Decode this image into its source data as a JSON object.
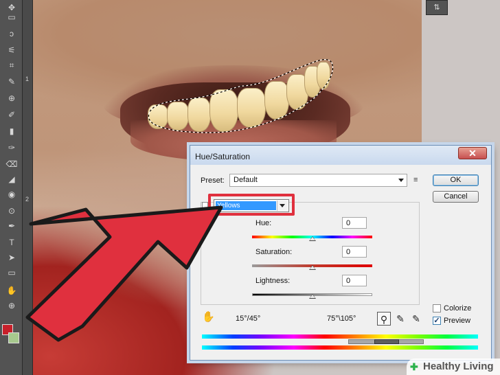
{
  "window": {
    "title": "Hue/Saturation",
    "close_glyph": "✕"
  },
  "preset": {
    "label": "Preset:",
    "value": "Default",
    "menu_icon": "list-menu-icon",
    "menu_glyph": "≡"
  },
  "buttons": {
    "ok": "OK",
    "cancel": "Cancel"
  },
  "edit": {
    "value": "Yellows"
  },
  "sliders": [
    {
      "label": "Hue:",
      "value": "0",
      "level": 0.5
    },
    {
      "label": "Saturation:",
      "value": "0",
      "level": 0.5
    },
    {
      "label": "Lightness:",
      "value": "0",
      "level": 0.5
    }
  ],
  "options": {
    "colorize_label": "Colorize",
    "colorize_checked": false,
    "preview_label": "Preview",
    "preview_checked": true,
    "check_glyph": "✓"
  },
  "range": {
    "left": "15°/45°",
    "right": "75°\\105°"
  },
  "tools": {
    "hand_glyph": "✋",
    "eyedropper_glyph": "⚲",
    "eyedropper_plus_glyph": "✎",
    "eyedropper_minus_glyph": "✎"
  },
  "ruler": {
    "marks": [
      "1",
      "2"
    ]
  },
  "toolbar_glyphs": [
    "✥",
    "▭",
    "ↄ",
    "⚟",
    "⌗",
    "✎",
    "⊕",
    "✐",
    "▮",
    "✑",
    "⌫",
    "◢",
    "◉",
    "⊙",
    "✒",
    "T",
    "➤",
    "▭",
    "✋",
    "⊕"
  ],
  "right_panel_glyph": "⇅",
  "watermark": {
    "text": "Healthy Living",
    "icon_glyph": "✚"
  },
  "colors": {
    "selection_highlight": "#e0303e",
    "selected_item": "#3399ff",
    "arrow": "#e0303e",
    "foreground_swatch": "#c8202a",
    "background_swatch": "#a7c98e"
  }
}
